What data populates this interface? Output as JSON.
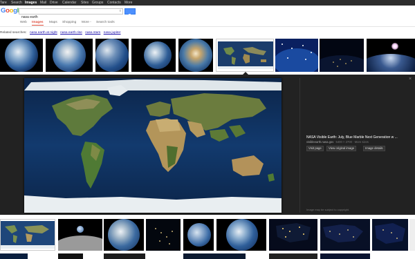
{
  "topbar": {
    "items": [
      "Tare",
      "Search",
      "Images",
      "Mail",
      "Drive",
      "Calendar",
      "Sites",
      "Groups",
      "Contacts",
      "More"
    ]
  },
  "search": {
    "query": "nasa earth",
    "clear_symbol": "x",
    "button_icon": "magnifier-icon"
  },
  "logo": {
    "text": "Google"
  },
  "tabs": [
    "Web",
    "Images",
    "Maps",
    "Shopping",
    "More -",
    "Search tools"
  ],
  "related": {
    "label": "Related searches:",
    "links": [
      "nasa earth at night",
      "nasa earth rise",
      "nasa stars",
      "nasa jupiter"
    ]
  },
  "preview": {
    "title": "NASA Visible Earth: July, Blue Marble Next Generation w ...",
    "source": "visibleearth.nasa.gov",
    "meta": "5400 × 2700 · More sizes",
    "buttons": [
      "Visit page",
      "View original image",
      "Image details"
    ],
    "copyright": "Image may be subject to copyright.",
    "close_symbol": "×"
  },
  "colors": {
    "topbar": "#2d2d2d",
    "search_button": "#4d90fe",
    "active_tab": "#dd4b39",
    "link": "#1a0dab",
    "preview_bg": "#222222"
  }
}
